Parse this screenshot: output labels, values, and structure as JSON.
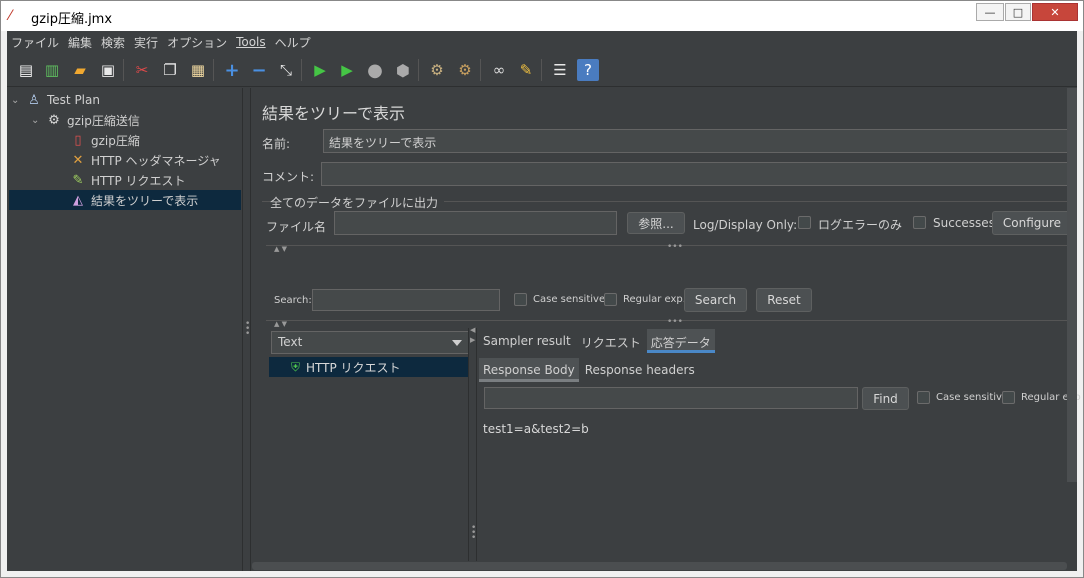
{
  "window": {
    "title": "gzip圧縮.jmx",
    "min": "—",
    "max": "□",
    "close": "✕"
  },
  "menu": [
    "ファイル",
    "編集",
    "検索",
    "実行",
    "オプション",
    "Tools",
    "ヘルプ"
  ],
  "tree": {
    "items": [
      {
        "label": "Test Plan",
        "icon": "flask-icon"
      },
      {
        "label": "gzip圧縮送信",
        "icon": "gear-icon"
      },
      {
        "label": "gzip圧縮",
        "icon": "document-icon"
      },
      {
        "label": "HTTP ヘッダマネージャ",
        "icon": "tools-icon"
      },
      {
        "label": "HTTP リクエスト",
        "icon": "pen-icon"
      },
      {
        "label": "結果をツリーで表示",
        "icon": "chart-icon"
      }
    ]
  },
  "panel": {
    "title": "結果をツリーで表示",
    "name_label": "名前:",
    "name_value": "結果をツリーで表示",
    "comment_label": "コメント:",
    "comment_value": "",
    "file_section_label": "全てのデータをファイルに出力",
    "filename_label": "ファイル名",
    "filename_value": "",
    "browse_button": "参照...",
    "log_display_label": "Log/Display Only:",
    "errors_only_label": "ログエラーのみ",
    "successes_label": "Successes",
    "configure_button": "Configure"
  },
  "search": {
    "label": "Search:",
    "value": "",
    "case_sensitive": "Case sensitive",
    "regular_exp": "Regular exp.",
    "search_button": "Search",
    "reset_button": "Reset"
  },
  "results": {
    "render_mode": "Text",
    "items": [
      "HTTP リクエスト"
    ]
  },
  "detail": {
    "tabs": [
      "Sampler result",
      "リクエスト",
      "応答データ"
    ],
    "active_tab": "応答データ",
    "subtabs": [
      "Response Body",
      "Response headers"
    ],
    "active_subtab": "Response Body",
    "find_value": "",
    "find_button": "Find",
    "case_sensitive": "Case sensitive",
    "regular_exp": "Regular exp",
    "body": "test1=a&test2=b"
  }
}
